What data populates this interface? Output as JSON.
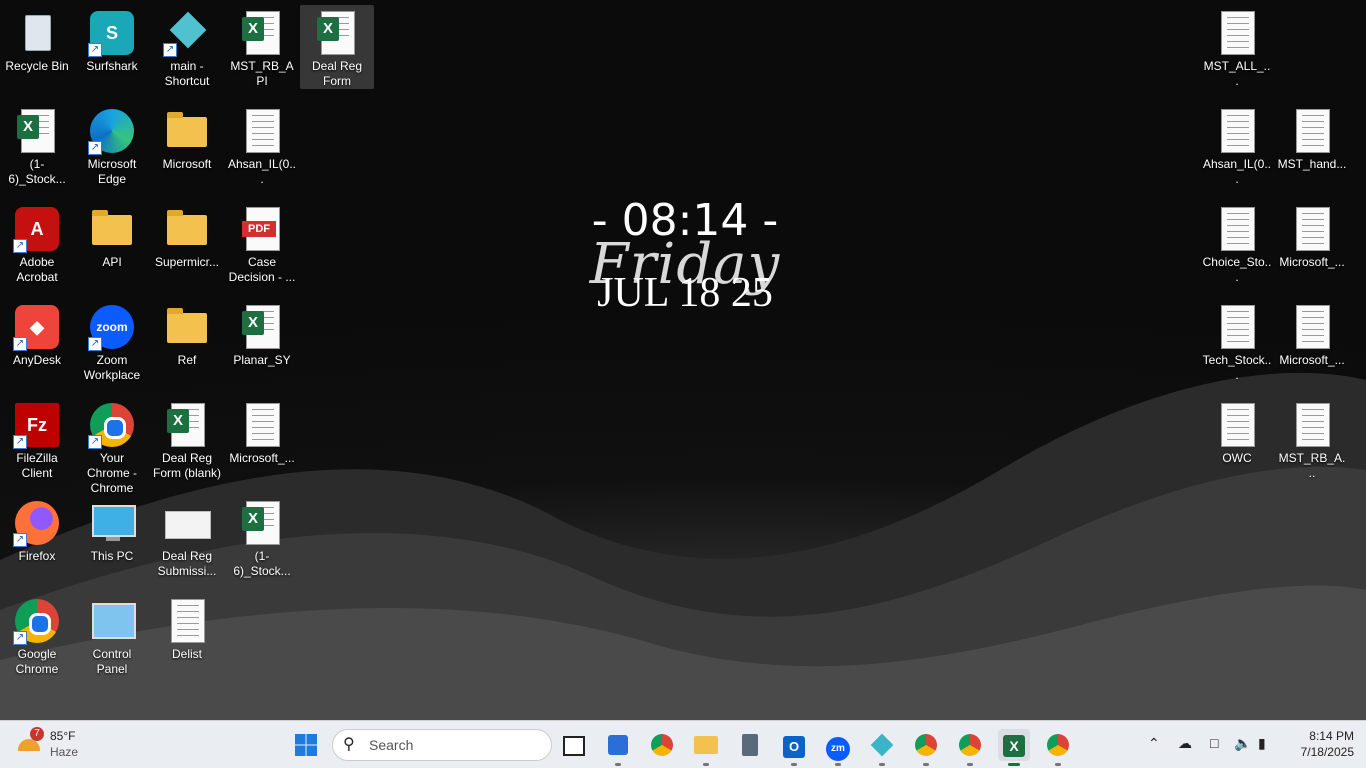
{
  "desktop": {
    "left_icons": [
      {
        "label": "Recycle Bin",
        "icon": "recycle-bin-icon",
        "shortcut": false
      },
      {
        "label": "Surfshark",
        "icon": "surfshark-icon",
        "shortcut": true
      },
      {
        "label": "main - Shortcut",
        "icon": "app-shortcut-icon",
        "shortcut": true
      },
      {
        "label": "MST_RB_API",
        "icon": "excel-file-icon",
        "shortcut": false
      },
      {
        "label": "Deal Reg Form",
        "icon": "excel-file-icon",
        "shortcut": false,
        "selected": true
      },
      {
        "label": "(1-6)_Stock...",
        "icon": "excel-file-icon",
        "shortcut": false
      },
      {
        "label": "Microsoft Edge",
        "icon": "edge-icon",
        "shortcut": true
      },
      {
        "label": "Microsoft",
        "icon": "folder-icon",
        "shortcut": false
      },
      {
        "label": "Ahsan_IL(0...",
        "icon": "text-file-icon",
        "shortcut": false
      },
      {
        "label": "Adobe Acrobat",
        "icon": "acrobat-icon",
        "shortcut": true
      },
      {
        "label": "API",
        "icon": "folder-icon",
        "shortcut": false
      },
      {
        "label": "Supermicr...",
        "icon": "folder-icon",
        "shortcut": false
      },
      {
        "label": "Case Decision - ...",
        "icon": "pdf-file-icon",
        "shortcut": false
      },
      {
        "label": "AnyDesk",
        "icon": "anydesk-icon",
        "shortcut": true
      },
      {
        "label": "Zoom Workplace",
        "icon": "zoom-icon",
        "shortcut": true
      },
      {
        "label": "Ref",
        "icon": "folder-icon",
        "shortcut": false
      },
      {
        "label": "Planar_SY",
        "icon": "excel-file-icon",
        "shortcut": false
      },
      {
        "label": "FileZilla Client",
        "icon": "filezilla-icon",
        "shortcut": true
      },
      {
        "label": "Your Chrome - Chrome",
        "icon": "chrome-profile-icon",
        "shortcut": true
      },
      {
        "label": "Deal Reg Form (blank)",
        "icon": "excel-file-icon",
        "shortcut": false
      },
      {
        "label": "Microsoft_...",
        "icon": "text-file-icon",
        "shortcut": false
      },
      {
        "label": "Firefox",
        "icon": "firefox-icon",
        "shortcut": true
      },
      {
        "label": "This PC",
        "icon": "monitor-icon",
        "shortcut": false
      },
      {
        "label": "Deal Reg Submissi...",
        "icon": "image-file-icon",
        "shortcut": false
      },
      {
        "label": "(1-6)_Stock...",
        "icon": "excel-file-icon",
        "shortcut": false
      },
      {
        "label": "Google Chrome",
        "icon": "chrome-icon",
        "shortcut": true
      },
      {
        "label": "Control Panel",
        "icon": "control-panel-icon",
        "shortcut": false
      },
      {
        "label": "Delist",
        "icon": "text-file-icon",
        "shortcut": false
      }
    ],
    "right_icons": [
      {
        "label": "MST_ALL_...",
        "icon": "text-file-icon"
      },
      {
        "label": "Ahsan_IL(0...",
        "icon": "text-file-icon"
      },
      {
        "label": "MST_hand...",
        "icon": "text-file-icon"
      },
      {
        "label": "Choice_Sto...",
        "icon": "text-file-icon"
      },
      {
        "label": "Microsoft_...",
        "icon": "text-file-icon"
      },
      {
        "label": "Tech_Stock...",
        "icon": "text-file-icon"
      },
      {
        "label": "Microsoft_...",
        "icon": "text-file-icon"
      },
      {
        "label": "OWC",
        "icon": "text-file-icon"
      },
      {
        "label": "MST_RB_A...",
        "icon": "text-file-icon"
      }
    ]
  },
  "clock_widget": {
    "time": "- 08:14 -",
    "day": "Friday",
    "date": "JUL 18 25"
  },
  "taskbar": {
    "weather": {
      "temp": "85°F",
      "condition": "Haze",
      "badge": "7"
    },
    "search_placeholder": "Search",
    "apps": [
      {
        "name": "start-button",
        "icon": "windows-icon"
      },
      {
        "name": "task-view",
        "icon": "task-view-icon"
      },
      {
        "name": "microsoft-store",
        "icon": "store-icon"
      },
      {
        "name": "chrome",
        "icon": "chrome-icon"
      },
      {
        "name": "file-explorer",
        "icon": "folder-icon"
      },
      {
        "name": "calculator",
        "icon": "calculator-icon"
      },
      {
        "name": "outlook",
        "icon": "outlook-icon"
      },
      {
        "name": "zoom",
        "icon": "zoom-icon"
      },
      {
        "name": "app-diamond",
        "icon": "diamond-icon"
      },
      {
        "name": "chrome-profile-1",
        "icon": "chrome-icon"
      },
      {
        "name": "chrome-profile-2",
        "icon": "chrome-icon"
      },
      {
        "name": "excel",
        "icon": "excel-icon"
      },
      {
        "name": "chrome-profile-3",
        "icon": "chrome-icon"
      }
    ],
    "clock": {
      "time": "8:14 PM",
      "date": "7/18/2025"
    }
  }
}
